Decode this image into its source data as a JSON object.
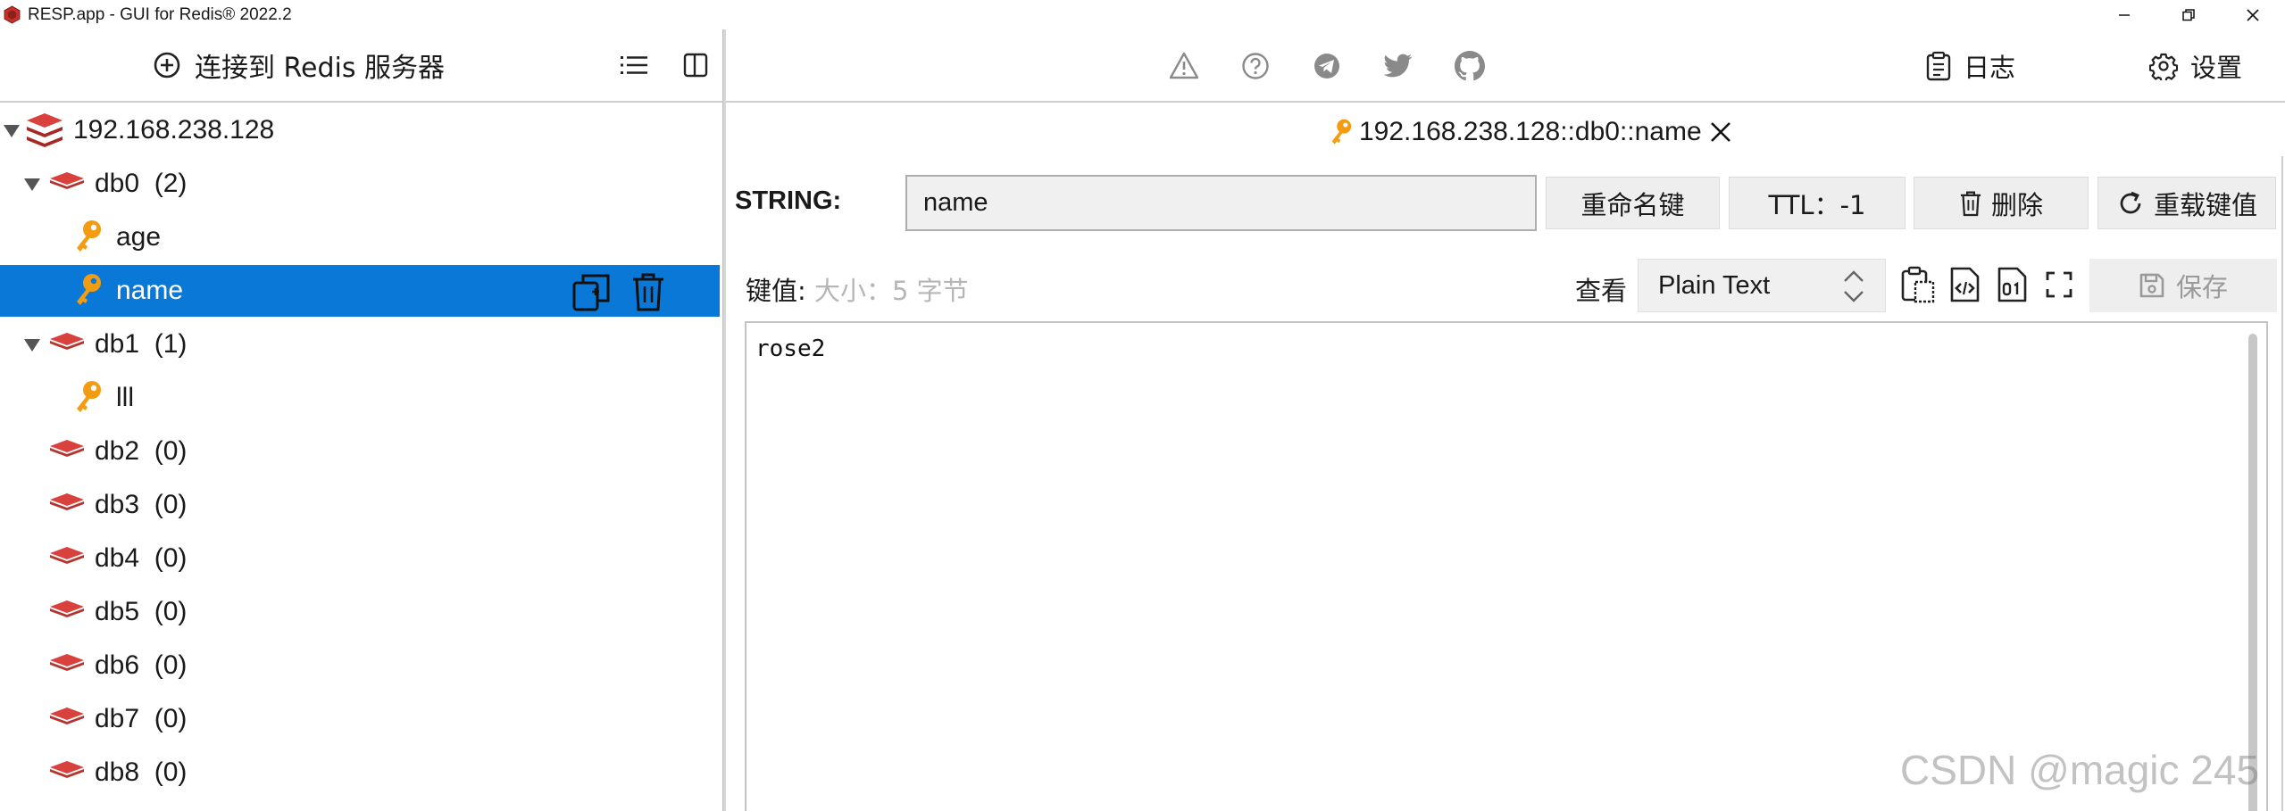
{
  "window": {
    "title": "RESP.app - GUI for Redis® 2022.2",
    "brand_color": "#c9302c"
  },
  "left_toolbar": {
    "connect_label": "连接到 Redis 服务器",
    "list_icon": "list-icon",
    "layout_icon": "split-view-icon"
  },
  "right_toolbar": {
    "icons": [
      "warning-icon",
      "help-icon",
      "telegram-icon",
      "twitter-icon",
      "github-icon"
    ],
    "log_label": "日志",
    "settings_label": "设置"
  },
  "tree": {
    "server": "192.168.238.128",
    "rows": [
      {
        "type": "db",
        "name": "db0",
        "count": "(2)",
        "expanded": true
      },
      {
        "type": "key",
        "name": "age"
      },
      {
        "type": "key",
        "name": "name",
        "selected": true
      },
      {
        "type": "db",
        "name": "db1",
        "count": "(1)",
        "expanded": true
      },
      {
        "type": "key",
        "name": "lll"
      },
      {
        "type": "db",
        "name": "db2",
        "count": "(0)"
      },
      {
        "type": "db",
        "name": "db3",
        "count": "(0)"
      },
      {
        "type": "db",
        "name": "db4",
        "count": "(0)"
      },
      {
        "type": "db",
        "name": "db5",
        "count": "(0)"
      },
      {
        "type": "db",
        "name": "db6",
        "count": "(0)"
      },
      {
        "type": "db",
        "name": "db7",
        "count": "(0)"
      },
      {
        "type": "db",
        "name": "db8",
        "count": "(0)"
      }
    ],
    "selected_color": "#0a78d7",
    "key_icon_color": "#f39c12",
    "db_icon_color": "#d9423c"
  },
  "key_view": {
    "tab_title": "192.168.238.128::db0::name",
    "type_label": "STRING:",
    "key_name": "name",
    "rename_label": "重命名键",
    "ttl_label": "TTL：-1",
    "delete_label": "删除",
    "reload_label": "重载键值",
    "value_label": "键值:",
    "value_size": "大小：5 字节",
    "view_label": "查看",
    "view_mode": "Plain Text",
    "save_label": "保存",
    "value": "rose2"
  },
  "watermark": "CSDN @magic 245"
}
